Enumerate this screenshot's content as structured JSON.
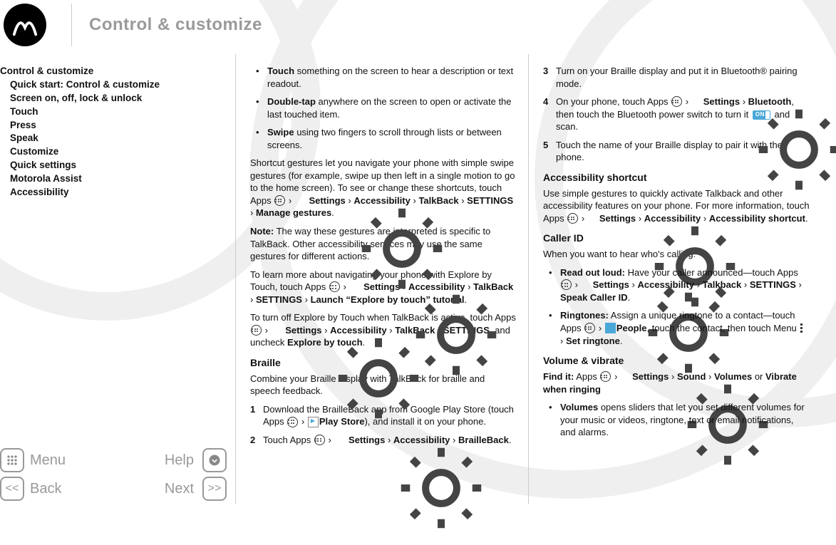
{
  "header": {
    "title": "Control & customize"
  },
  "nav": [
    {
      "label": "Control & customize",
      "level": 1,
      "key": "nav0"
    },
    {
      "label": "Quick start: Control & customize",
      "level": 2,
      "key": "nav1"
    },
    {
      "label": "Screen on, off, lock & unlock",
      "level": 2,
      "key": "nav2"
    },
    {
      "label": "Touch",
      "level": 2,
      "key": "nav3"
    },
    {
      "label": "Press",
      "level": 2,
      "key": "nav4"
    },
    {
      "label": "Speak",
      "level": 2,
      "key": "nav5"
    },
    {
      "label": "Customize",
      "level": 2,
      "key": "nav6"
    },
    {
      "label": "Quick settings",
      "level": 2,
      "key": "nav7"
    },
    {
      "label": "Motorola Assist",
      "level": 2,
      "key": "nav8"
    },
    {
      "label": "Accessibility",
      "level": 2,
      "key": "nav9"
    }
  ],
  "bottom": {
    "menu": "Menu",
    "help": "Help",
    "back": "Back",
    "next": "Next"
  },
  "col1": {
    "b1_lead": "Touch",
    "b1_rest": " something on the screen to hear a description or text readout.",
    "b2_lead": "Double-tap",
    "b2_rest": " anywhere on the screen to open or activate the last touched item.",
    "b3_lead": "Swipe",
    "b3_rest": " using two fingers to scroll through lists or between screens.",
    "p1_a": "Shortcut gestures let you navigate your phone with simple swipe gestures (for example, swipe up then left in a single motion to go to the home screen). To see or change these shortcuts, touch Apps ",
    "p1_b": " Settings",
    "p1_c": "Accessibility",
    "p1_d": "TalkBack",
    "p1_e": "SETTINGS",
    "p1_f": "Manage gestures",
    "p2_lead": "Note:",
    "p2_rest": " The way these gestures are interpreted is specific to TalkBack. Other accessibility services may use the same gestures for different actions.",
    "p3_a": "To learn more about navigating your phone with Explore by Touch, touch Apps ",
    "p3_f": "Launch “Explore by touch” tutorial",
    "p4_a": "To turn off Explore by Touch when TalkBack is active, touch Apps ",
    "p4_tb": "TalkBack",
    "p4_set": "SETTINGS",
    "p4_end": ", and uncheck ",
    "p4_ebt": "Explore by touch",
    "h_braille": "Braille",
    "p5": "Combine your Braille display with TalkBack for braille and speech feedback.",
    "s1_a": "Download the BrailleBack app from Google Play Store (touch Apps ",
    "s1_ps": "Play Store",
    "s1_b": "), and install it on your phone.",
    "s2_a": "Touch Apps ",
    "s2_bb": "BrailleBack"
  },
  "col2": {
    "s3": "Turn on your Braille display and put it in Bluetooth® pairing mode.",
    "s4_a": "On your phone, touch Apps ",
    "s4_set": "Settings",
    "s4_bt": "Bluetooth",
    "s4_b": ", then touch the Bluetooth power switch to turn it ",
    "s4_on": "ON",
    "s4_c": " and scan.",
    "s5": "Touch the name of your Braille display to pair it with the phone.",
    "h_as": "Accessibility shortcut",
    "p_as_a": "Use simple gestures to quickly activate Talkback and other accessibility features on your phone. For more information, touch Apps ",
    "p_as_acc": "Accessibility",
    "p_as_sc": "Accessibility shortcut",
    "h_cid": "Caller ID",
    "p_cid": "When you want to hear who's calling:",
    "cb1_lead": "Read out loud:",
    "cb1_a": " Have your caller announced—touch Apps ",
    "cb1_tb": "Talkback",
    "cb1_set": "SETTINGS",
    "cb1_sci": "Speak Caller ID",
    "cb2_lead": "Ringtones:",
    "cb2_a": " Assign a unique ringtone to a contact—touch Apps ",
    "cb2_people": "People",
    "cb2_b": ", touch the contact, then touch Menu ",
    "cb2_sr": "Set ringtone",
    "h_vv": "Volume & vibrate",
    "p_vv_lead": "Find it:",
    "p_vv_a": " Apps ",
    "p_vv_snd": "Sound",
    "p_vv_vol": "Volumes",
    "p_vv_or": " or ",
    "p_vv_vwr": "Vibrate when ringing",
    "vb_lead": "Volumes",
    "vb_rest": " opens sliders that let you set different volumes for your music or videos, ringtone, text or email notifications, and alarms.",
    "settings": "Settings",
    "arrow": "›"
  },
  "glyphs": {
    "arrow": "›"
  }
}
